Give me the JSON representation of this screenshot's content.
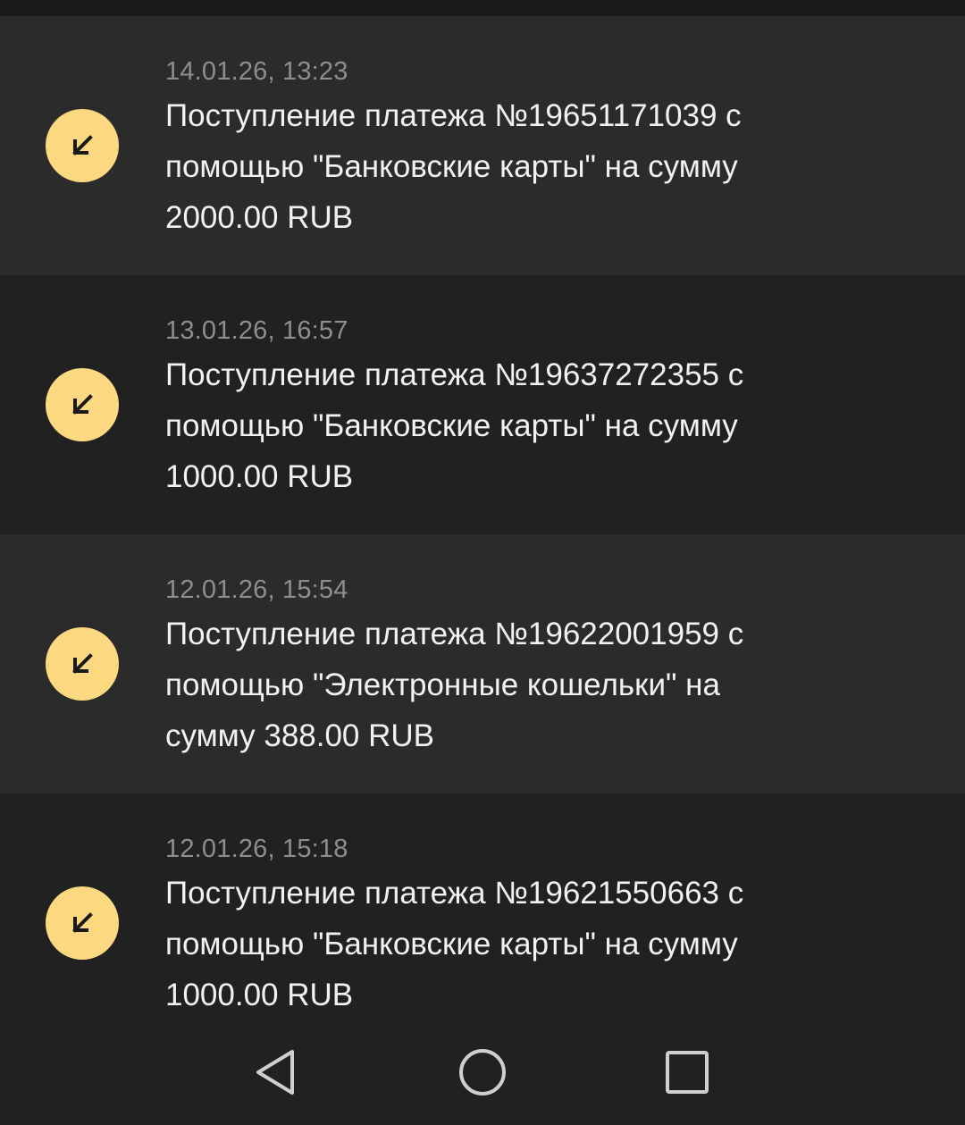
{
  "transactions": [
    {
      "datetime": "14.01.26, 13:23",
      "line1": "Поступление платежа №19651171039 с",
      "line2": "помощью \"Банковские карты\" на сумму",
      "line3": "2000.00 RUB",
      "icon": "arrow-down-left-icon"
    },
    {
      "datetime": "13.01.26, 16:57",
      "line1": "Поступление платежа №19637272355 с",
      "line2": "помощью \"Банковские карты\" на сумму",
      "line3": "1000.00 RUB",
      "icon": "arrow-down-left-icon"
    },
    {
      "datetime": "12.01.26, 15:54",
      "line1": "Поступление платежа №19622001959 с",
      "line2": "помощью \"Электронные кошельки\" на",
      "line3": "сумму 388.00 RUB",
      "icon": "arrow-down-left-icon"
    },
    {
      "datetime": "12.01.26, 15:18",
      "line1": "Поступление платежа №19621550663 с",
      "line2": "помощью \"Банковские карты\" на сумму",
      "line3": "1000.00 RUB",
      "icon": "arrow-down-left-icon"
    }
  ],
  "navbar": {
    "back": "back-triangle-icon",
    "home": "home-circle-icon",
    "recents": "recents-square-icon"
  },
  "colors": {
    "icon_bg": "#fcd980",
    "row_light": "#2b2b2b",
    "row_dark": "#212121",
    "date_text": "#8e8e8e",
    "body_text": "#f2f2f2"
  }
}
